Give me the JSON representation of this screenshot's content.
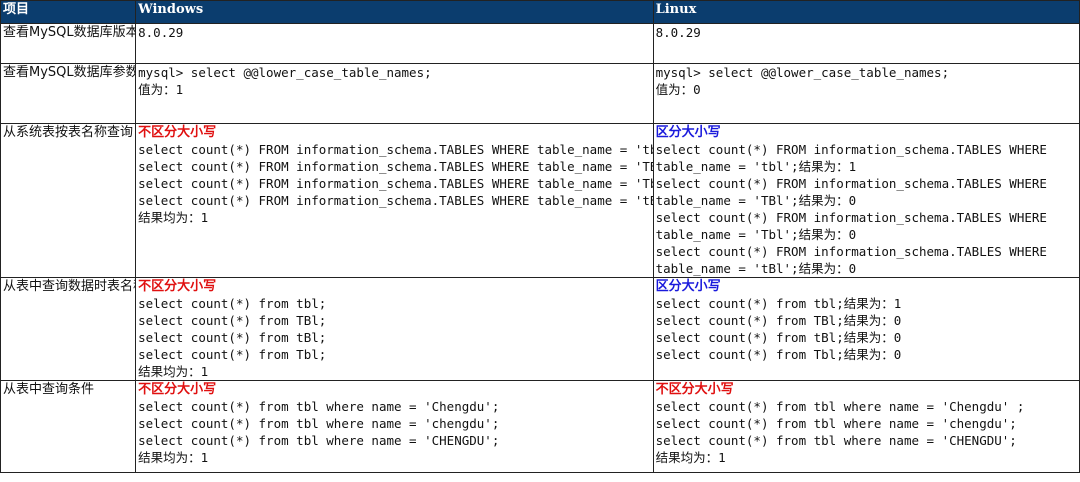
{
  "header": {
    "col1": "项目",
    "col2": "Windows",
    "col3": "Linux"
  },
  "rows": [
    {
      "label": "查看MySQL数据库版本",
      "windows": [
        "8.0.29"
      ],
      "linux": [
        "8.0.29"
      ]
    },
    {
      "label": "查看MySQL数据库参数lower_case_table_names",
      "windows": [
        "mysql> select @@lower_case_table_names;",
        "值为：1"
      ],
      "linux": [
        "mysql> select @@lower_case_table_names;",
        "值为：0"
      ]
    },
    {
      "label": "从系统表按表名称查询",
      "windows_heading": "不区分大小写",
      "windows": [
        "select count(*) FROM information_schema.TABLES WHERE table_name = 'tbl';",
        "select count(*) FROM information_schema.TABLES WHERE table_name = 'TBl';",
        "select count(*) FROM information_schema.TABLES WHERE table_name = 'Tbl';",
        "select count(*) FROM information_schema.TABLES WHERE table_name = 'tBl';",
        "结果均为：1"
      ],
      "linux_heading": "区分大小写",
      "linux": [
        "select count(*) FROM information_schema.TABLES WHERE",
        "table_name = 'tbl';结果为：1",
        "select count(*) FROM information_schema.TABLES WHERE",
        "table_name = 'TBl';结果为：0",
        "select count(*) FROM information_schema.TABLES WHERE",
        "table_name = 'Tbl';结果为：0",
        "select count(*) FROM information_schema.TABLES WHERE",
        "table_name = 'tBl';结果为：0"
      ]
    },
    {
      "label": "从表中查询数据时表名称",
      "windows_heading": "不区分大小写",
      "windows": [
        "select count(*) from tbl;",
        "select count(*) from TBl;",
        "select count(*) from tBl;",
        "select count(*) from Tbl;",
        "结果均为：1"
      ],
      "linux_heading": "区分大小写",
      "linux": [
        "select count(*) from tbl;结果为：1",
        "select count(*) from TBl;结果为：0",
        "select count(*) from tBl;结果为：0",
        "select count(*) from Tbl;结果为：0"
      ]
    },
    {
      "label": "从表中查询条件",
      "windows_heading": "不区分大小写",
      "windows": [
        "select count(*) from tbl where name = 'Chengdu';",
        "select count(*) from tbl where name = 'chengdu';",
        "select count(*) from tbl where name = 'CHENGDU';",
        "结果均为：1"
      ],
      "linux_heading": "不区分大小写",
      "linux": [
        "select count(*) from tbl where name = 'Chengdu' ;",
        "select count(*) from tbl where name = 'chengdu';",
        "select count(*) from tbl where name = 'CHENGDU';",
        "结果均为：1"
      ]
    }
  ]
}
